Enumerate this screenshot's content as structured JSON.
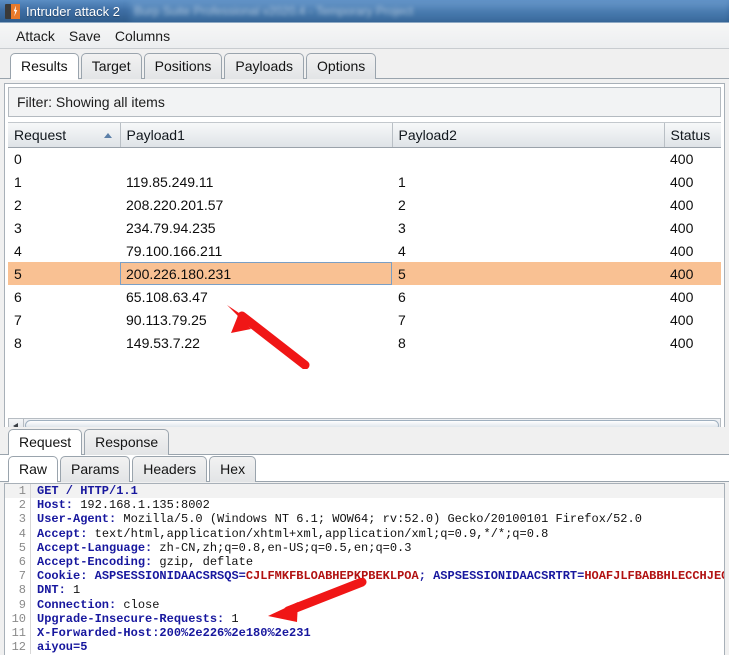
{
  "titlebar": {
    "app_title": "Intruder attack 2",
    "icon": "burp-suite-icon",
    "background_ghost": "Burp Suite Professional v2020.4 - Temporary Project"
  },
  "menubar": {
    "items": [
      {
        "label": "Attack"
      },
      {
        "label": "Save"
      },
      {
        "label": "Columns"
      }
    ]
  },
  "tabs": {
    "items": [
      {
        "label": "Results",
        "active": true
      },
      {
        "label": "Target",
        "active": false
      },
      {
        "label": "Positions",
        "active": false
      },
      {
        "label": "Payloads",
        "active": false
      },
      {
        "label": "Options",
        "active": false
      }
    ]
  },
  "filter": {
    "text": "Filter: Showing all items"
  },
  "results_table": {
    "columns": [
      {
        "label": "Request",
        "sorted": "asc"
      },
      {
        "label": "Payload1",
        "sorted": ""
      },
      {
        "label": "Payload2",
        "sorted": ""
      },
      {
        "label": "Status",
        "sorted": ""
      }
    ],
    "rows": [
      {
        "request": "0",
        "payload1": "",
        "payload2": "",
        "status": "400",
        "selected": false
      },
      {
        "request": "1",
        "payload1": "119.85.249.11",
        "payload2": "1",
        "status": "400",
        "selected": false
      },
      {
        "request": "2",
        "payload1": "208.220.201.57",
        "payload2": "2",
        "status": "400",
        "selected": false
      },
      {
        "request": "3",
        "payload1": "234.79.94.235",
        "payload2": "3",
        "status": "400",
        "selected": false
      },
      {
        "request": "4",
        "payload1": "79.100.166.211",
        "payload2": "4",
        "status": "400",
        "selected": false
      },
      {
        "request": "5",
        "payload1": "200.226.180.231",
        "payload2": "5",
        "status": "400",
        "selected": true
      },
      {
        "request": "6",
        "payload1": "65.108.63.47",
        "payload2": "6",
        "status": "400",
        "selected": false
      },
      {
        "request": "7",
        "payload1": "90.113.79.25",
        "payload2": "7",
        "status": "400",
        "selected": false
      },
      {
        "request": "8",
        "payload1": "149.53.7.22",
        "payload2": "8",
        "status": "400",
        "selected": false
      }
    ],
    "selected_cell": "200.226.180.231"
  },
  "message_tabs": {
    "items": [
      {
        "label": "Request",
        "active": true
      },
      {
        "label": "Response",
        "active": false
      }
    ]
  },
  "view_tabs": {
    "items": [
      {
        "label": "Raw",
        "active": true
      },
      {
        "label": "Params",
        "active": false
      },
      {
        "label": "Headers",
        "active": false
      },
      {
        "label": "Hex",
        "active": false
      }
    ]
  },
  "request_editor": {
    "lines": [
      {
        "n": "1",
        "type": "plain",
        "text": "GET / HTTP/1.1"
      },
      {
        "n": "2",
        "type": "header",
        "name": "Host:",
        "value": " 192.168.1.135:8002"
      },
      {
        "n": "3",
        "type": "header",
        "name": "User-Agent:",
        "value": " Mozilla/5.0 (Windows NT 6.1; WOW64; rv:52.0) Gecko/20100101 Firefox/52.0"
      },
      {
        "n": "4",
        "type": "header",
        "name": "Accept:",
        "value": " text/html,application/xhtml+xml,application/xml;q=0.9,*/*;q=0.8"
      },
      {
        "n": "5",
        "type": "header",
        "name": "Accept-Language:",
        "value": " zh-CN,zh;q=0.8,en-US;q=0.5,en;q=0.3"
      },
      {
        "n": "6",
        "type": "header",
        "name": "Accept-Encoding:",
        "value": " gzip, deflate"
      },
      {
        "n": "7",
        "type": "cookie",
        "name": "Cookie:",
        "ck1": " ASPSESSIONIDAACSRSQS=",
        "cv1": "CJLFMKFBLOABHEPKPBEKLPOA",
        "sep": "; ",
        "ck2": "ASPSESSIONIDAACSRTRT=",
        "cv2": "HOAFJLFBABBHLECCHJEGMIMO"
      },
      {
        "n": "8",
        "type": "header",
        "name": "DNT:",
        "value": " 1"
      },
      {
        "n": "9",
        "type": "header",
        "name": "Connection:",
        "value": " close"
      },
      {
        "n": "10",
        "type": "header",
        "name": "Upgrade-Insecure-Requests:",
        "value": " 1"
      },
      {
        "n": "11",
        "type": "plain",
        "text": "X-Forwarded-Host:200%2e226%2e180%2e231"
      },
      {
        "n": "12",
        "type": "plain",
        "text": "aiyou=5"
      }
    ]
  },
  "annotations": {
    "arrow_color": "#f01616",
    "arrow_table_target": "200.226.180.231",
    "arrow_editor_target": "Upgrade-Insecure-Requests: 1"
  }
}
